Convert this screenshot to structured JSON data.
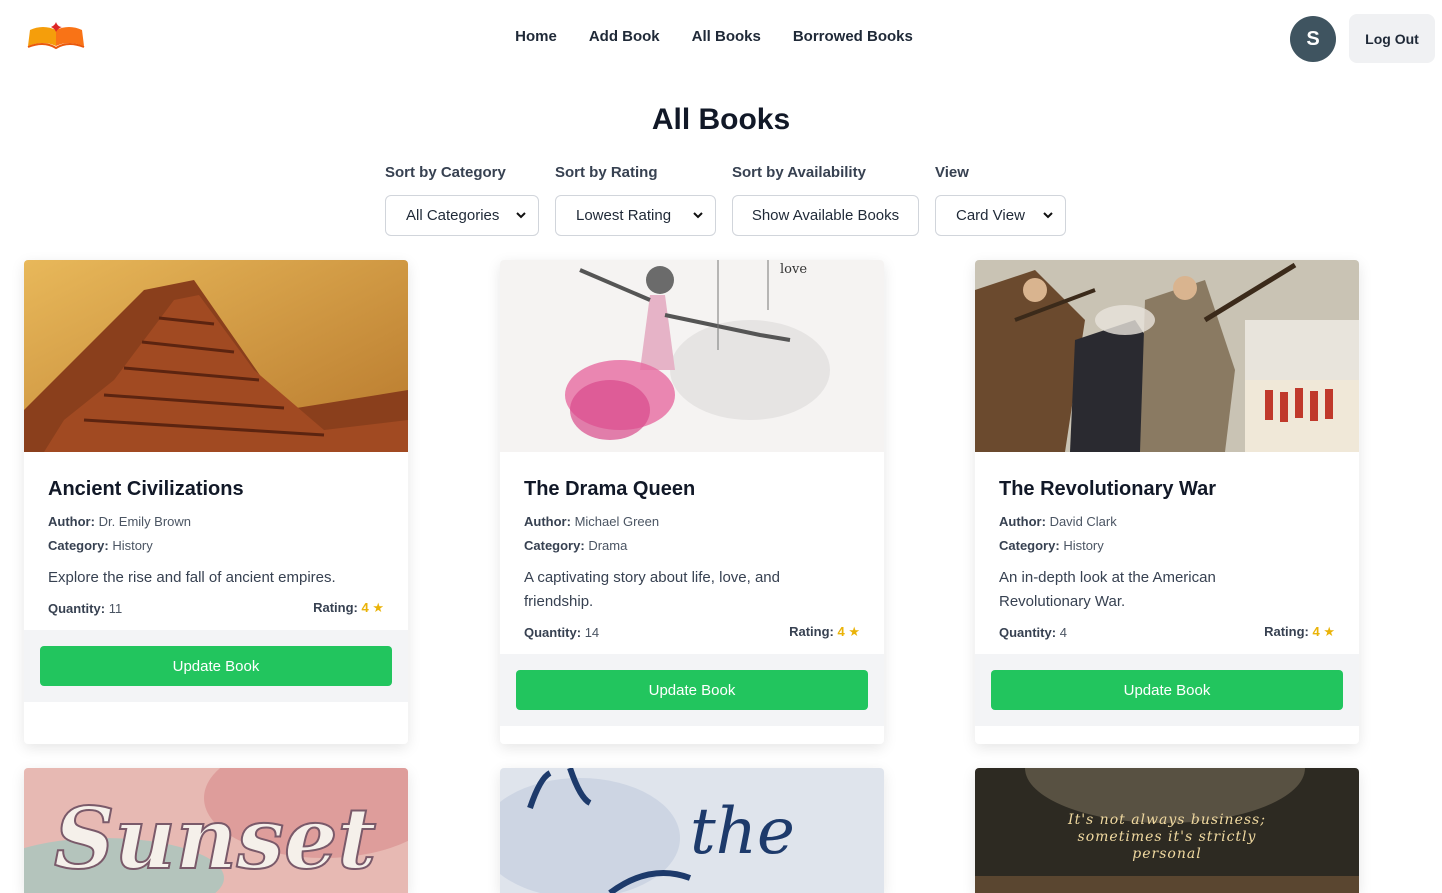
{
  "nav": {
    "logo_icon": "open-book-logo-icon",
    "links": [
      "Home",
      "Add Book",
      "All Books",
      "Borrowed Books"
    ],
    "avatar_initial": "S",
    "logout_label": "Log Out"
  },
  "page": {
    "title": "All Books"
  },
  "filters": {
    "category": {
      "label": "Sort by Category",
      "value": "All Categories"
    },
    "rating": {
      "label": "Sort by Rating",
      "value": "Lowest Rating"
    },
    "availability": {
      "label": "Sort by Availability",
      "value": "Show Available Books"
    },
    "view": {
      "label": "View",
      "value": "Card View"
    }
  },
  "labels": {
    "author": "Author:",
    "category": "Category:",
    "quantity": "Quantity:",
    "rating": "Rating:",
    "star": "★",
    "update": "Update Book"
  },
  "books": [
    {
      "title": "Ancient Civilizations",
      "author": "Dr. Emily Brown",
      "category": "History",
      "description": "Explore the rise and fall of ancient empires.",
      "quantity": "11",
      "rating": "4"
    },
    {
      "title": "The Drama Queen",
      "author": "Michael Green",
      "category": "Drama",
      "description": "A captivating story about life, love, and friendship.",
      "quantity": "14",
      "rating": "4",
      "cover_text": "love"
    },
    {
      "title": "The Revolutionary War",
      "author": "David Clark",
      "category": "History",
      "description": "An in-depth look at the American Revolutionary War.",
      "quantity": "4",
      "rating": "4"
    },
    {
      "cover_text": "Sunset"
    },
    {
      "cover_text": "the"
    },
    {
      "cover_text": "It's not always business; sometimes it's strictly personal"
    }
  ],
  "colors": {
    "accent_green": "#22c55e",
    "star": "#eab308",
    "avatar": "#3f5460"
  }
}
